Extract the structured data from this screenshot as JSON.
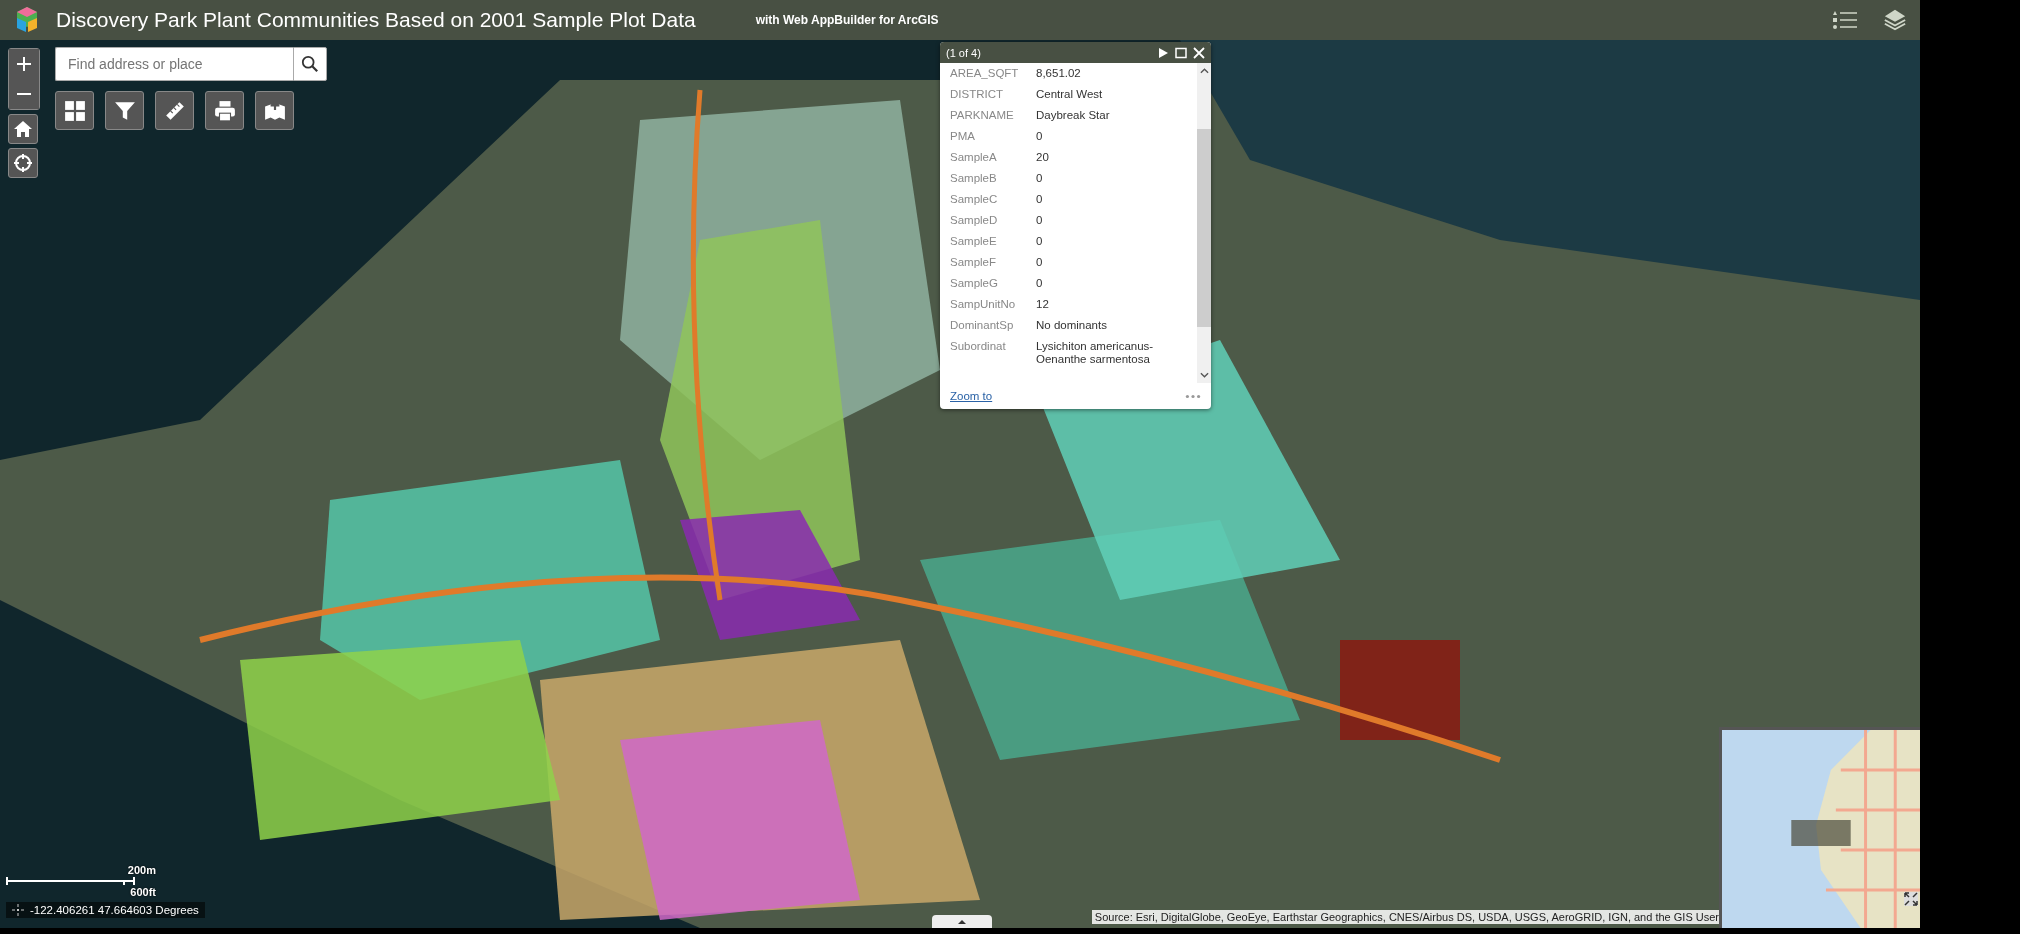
{
  "header": {
    "title": "Discovery Park Plant Communities Based on 2001 Sample Plot Data",
    "subtitle": "with Web AppBuilder for ArcGIS"
  },
  "search": {
    "placeholder": "Find address or place"
  },
  "popup": {
    "counter": "(1 of 4)",
    "fields": [
      {
        "label": "AREA_SQFT",
        "value": "8,651.02"
      },
      {
        "label": "DISTRICT",
        "value": "Central West"
      },
      {
        "label": "PARKNAME",
        "value": "Daybreak Star"
      },
      {
        "label": "PMA",
        "value": "0"
      },
      {
        "label": "SampleA",
        "value": "20"
      },
      {
        "label": "SampleB",
        "value": "0"
      },
      {
        "label": "SampleC",
        "value": "0"
      },
      {
        "label": "SampleD",
        "value": "0"
      },
      {
        "label": "SampleE",
        "value": "0"
      },
      {
        "label": "SampleF",
        "value": "0"
      },
      {
        "label": "SampleG",
        "value": "0"
      },
      {
        "label": "SampUnitNo",
        "value": "12"
      },
      {
        "label": "DominantSp",
        "value": "No dominants"
      },
      {
        "label": "Subordinat",
        "value": "Lysichiton americanus-Oenanthe sarmentosa"
      }
    ],
    "link": "Zoom to"
  },
  "scalebar": {
    "metric": "200m",
    "imperial": "600ft"
  },
  "coordinates": "-122.406261 47.664603 Degrees",
  "attribution": "Source: Esri, DigitalGlobe, GeoEye, Earthstar Geographics, CNES/Airbus DS, USDA, USGS, AeroGRID, IGN, and the GIS User"
}
